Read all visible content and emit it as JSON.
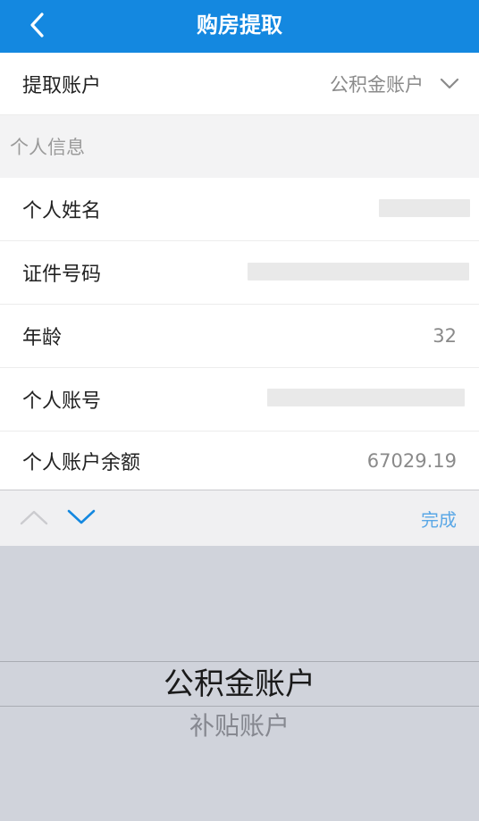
{
  "header": {
    "title": "购房提取",
    "back_icon": "chevron-left-icon"
  },
  "withdraw_account": {
    "label": "提取账户",
    "value": "公积金账户",
    "icon": "chevron-down-icon"
  },
  "section": {
    "title": "个人信息"
  },
  "fields": {
    "name": {
      "label": "个人姓名"
    },
    "id_number": {
      "label": "证件号码"
    },
    "age": {
      "label": "年龄",
      "value": "32"
    },
    "account_number": {
      "label": "个人账号"
    },
    "balance": {
      "label": "个人账户余额",
      "value": "67029.19"
    }
  },
  "toolbar": {
    "prev_icon": "chevron-up-icon",
    "next_icon": "chevron-down-icon",
    "done_label": "完成"
  },
  "picker": {
    "options": [
      "公积金账户",
      "补贴账户"
    ],
    "selected": "公积金账户"
  },
  "colors": {
    "brand": "#1488e0",
    "done": "#5aa7e6",
    "picker_bg": "#d0d3db"
  }
}
